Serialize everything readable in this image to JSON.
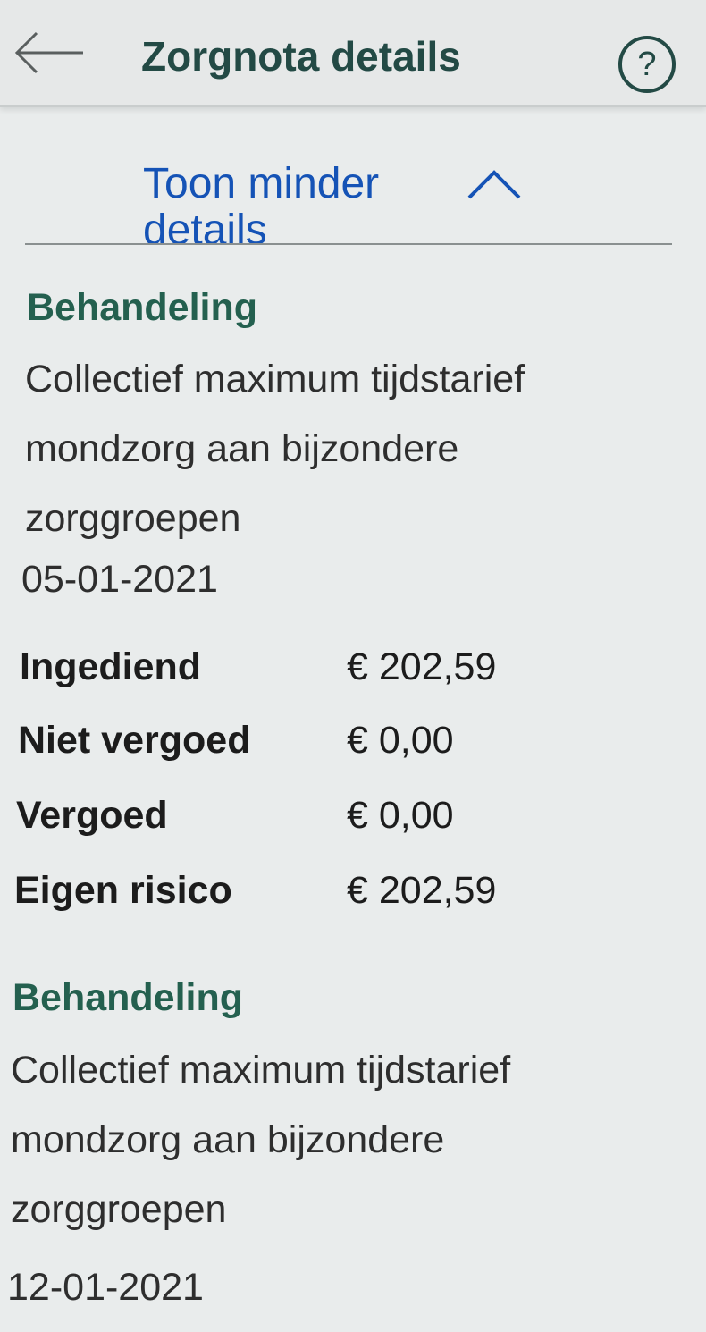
{
  "header": {
    "title": "Zorgnota details",
    "back_icon": "arrow-left-icon",
    "help_label": "?"
  },
  "toggle": {
    "label": "Toon minder details",
    "icon": "chevron-up-icon"
  },
  "colors": {
    "accent_blue": "#1553b6",
    "heading_green": "#24604f",
    "title_green": "#234a45"
  },
  "treatments": [
    {
      "heading": "Behandeling",
      "description_lines": [
        "Collectief maximum tijdstarief",
        "mondzorg aan bijzondere",
        "zorggroepen"
      ],
      "date": "05-01-2021",
      "amounts": [
        {
          "label": "Ingediend",
          "value": "€ 202,59"
        },
        {
          "label": "Niet vergoed",
          "value": "€ 0,00"
        },
        {
          "label": "Vergoed",
          "value": "€ 0,00"
        },
        {
          "label": "Eigen risico",
          "value": "€ 202,59"
        }
      ]
    },
    {
      "heading": "Behandeling",
      "description_lines": [
        "Collectief maximum tijdstarief",
        "mondzorg aan bijzondere",
        "zorggroepen"
      ],
      "date": "12-01-2021"
    }
  ]
}
